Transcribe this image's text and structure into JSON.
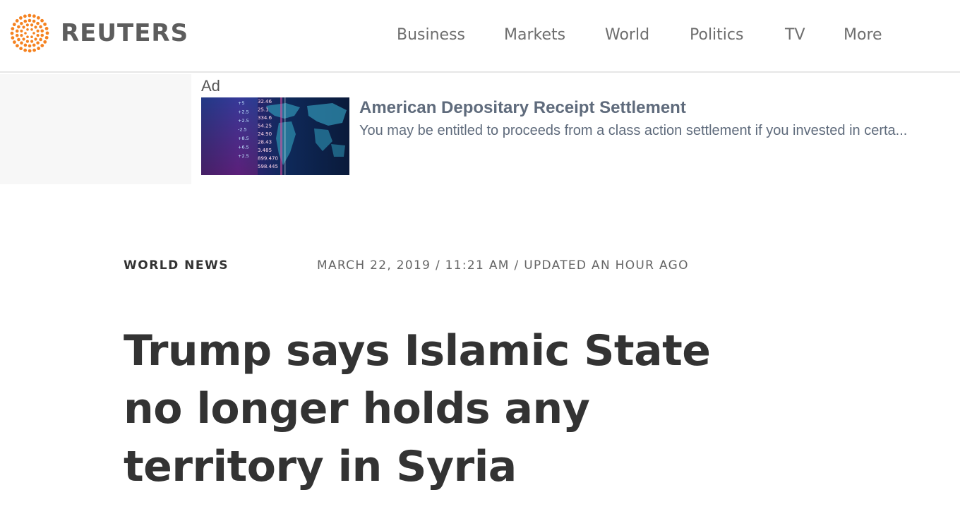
{
  "header": {
    "logo_text": "REUTERS",
    "brand_color": "#f58220",
    "nav": [
      {
        "label": "Business"
      },
      {
        "label": "Markets"
      },
      {
        "label": "World"
      },
      {
        "label": "Politics"
      },
      {
        "label": "TV"
      },
      {
        "label": "More"
      }
    ]
  },
  "ad": {
    "label": "Ad",
    "title": "American Depositary Receipt Settlement",
    "description": "You may be entitled to proceeds from a class action settlement if you invested in certa...",
    "image_ticker_values": [
      "32.46",
      "25.1",
      "334.6",
      "54.25",
      "24.90",
      "28.43",
      "3.485",
      "899.470",
      "598.445"
    ],
    "image_change_values": [
      "+5",
      "+2.5",
      "+2.5",
      "-2.5",
      "+8.5",
      "+6.5",
      "+2.5"
    ]
  },
  "article": {
    "section": "WORLD NEWS",
    "date": "MARCH 22, 2019",
    "time": "11:21 AM",
    "updated": "UPDATED AN HOUR AGO",
    "separator": " / ",
    "headline": "Trump says Islamic State no longer holds any territory in Syria"
  }
}
